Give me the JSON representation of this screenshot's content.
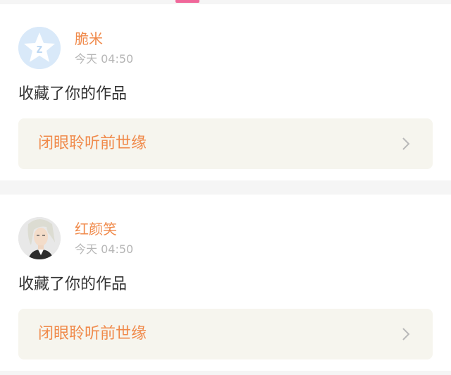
{
  "colors": {
    "accent": "#f08a4b",
    "tab_indicator": "#f0679a",
    "time_text": "#b6b6b6",
    "body_text": "#333333",
    "link_card_bg": "#f6f5ee",
    "default_avatar_bg": "#d9e9f9"
  },
  "notifications": [
    {
      "avatar_icon": "qzone-default-avatar-icon",
      "username": "脆米",
      "time": "今天 04:50",
      "action": "收藏了你的作品",
      "work_title": "闭眼聆听前世缘",
      "chevron_icon": "chevron-right-icon"
    },
    {
      "avatar_icon": "user-photo-avatar",
      "username": "红颜笑",
      "time": "今天 04:50",
      "action": "收藏了你的作品",
      "work_title": "闭眼聆听前世缘",
      "chevron_icon": "chevron-right-icon"
    }
  ]
}
